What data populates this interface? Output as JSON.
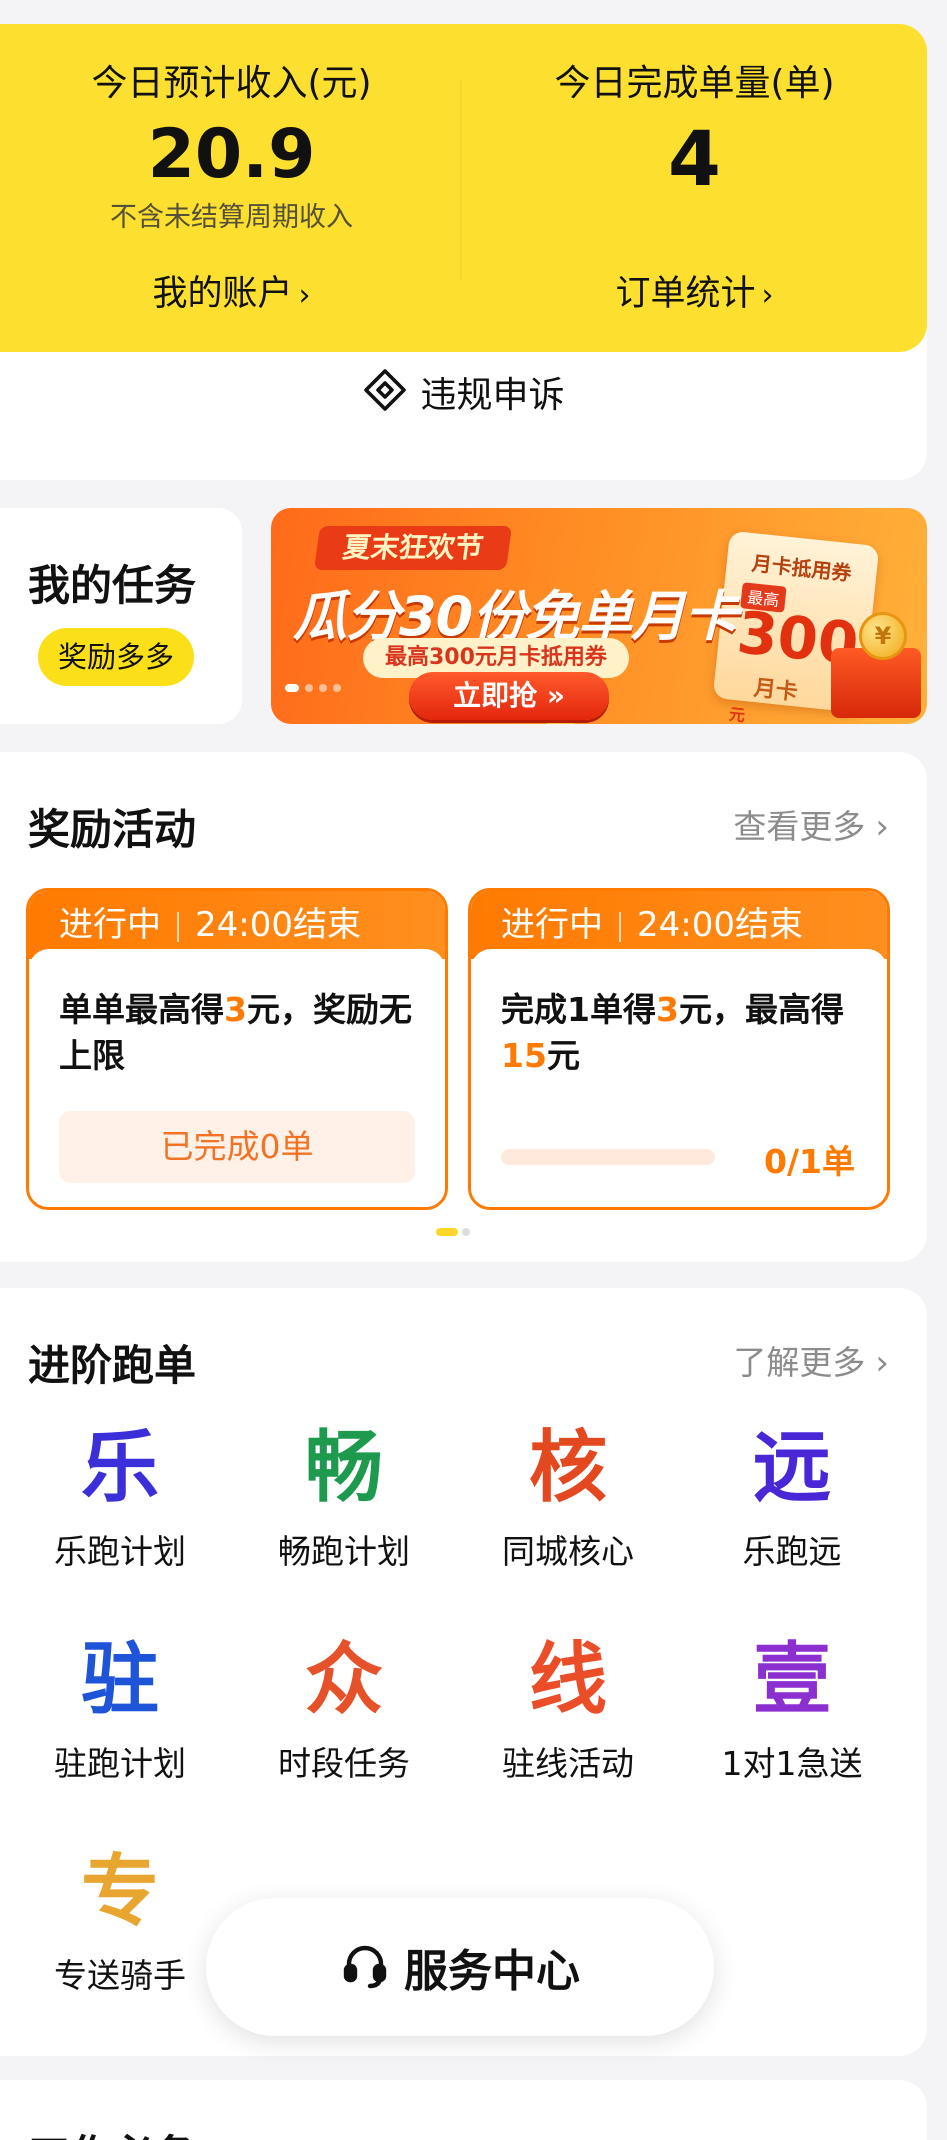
{
  "stats": {
    "income_title": "今日预计收入(元)",
    "income_value": "20.9",
    "income_note": "不含未结算周期收入",
    "account_link": "我的账户",
    "orders_title": "今日完成单量(单)",
    "orders_value": "4",
    "orders_link": "订单统计",
    "chevron": "›"
  },
  "appeal": {
    "label": "违规申诉",
    "icon": "ticket-icon"
  },
  "task": {
    "title": "我的任务",
    "badge": "奖励多多"
  },
  "banner": {
    "tag": "夏末狂欢节",
    "headline": "瓜分30份免单月卡",
    "sub": "最高300元月卡抵用券",
    "button": "立即抢 »",
    "coupon_title": "月卡抵用券",
    "coupon_max": "最高",
    "coupon_amount": "300",
    "coupon_unit": "元",
    "coupon_foot": "月卡",
    "coin": "¥"
  },
  "rewards": {
    "title": "奖励活动",
    "more": "查看更多",
    "chevron": "›",
    "cards": [
      {
        "status": "进行中",
        "end": "24:00结束",
        "text_a": "单单最高得",
        "text_hl1": "3",
        "text_b": "元，奖励无上限",
        "progress_text": "已完成0单"
      },
      {
        "status": "进行中",
        "end": "24:00结束",
        "text_a": "完成1单得",
        "text_hl1": "3",
        "text_b": "元，最高得",
        "text_hl2": "15",
        "text_c": "元",
        "progress_fraction": 0,
        "progress_label": "0/1单"
      }
    ]
  },
  "advanced": {
    "title": "进阶跑单",
    "more": "了解更多",
    "chevron": "›",
    "items": [
      {
        "glyph": "乐",
        "label": "乐跑计划",
        "color": "#3b2fd9"
      },
      {
        "glyph": "畅",
        "label": "畅跑计划",
        "color": "#1e9a4e"
      },
      {
        "glyph": "核",
        "label": "同城核心",
        "color": "#e4481f"
      },
      {
        "glyph": "远",
        "label": "乐跑远",
        "color": "#4a27d6"
      },
      {
        "glyph": "驻",
        "label": "驻跑计划",
        "color": "#1d54d8"
      },
      {
        "glyph": "众",
        "label": "时段任务",
        "color": "#e5522a"
      },
      {
        "glyph": "线",
        "label": "驻线活动",
        "color": "#ea4d27"
      },
      {
        "glyph": "壹",
        "label": "1对1急送",
        "color": "#8b2fd0"
      },
      {
        "glyph": "专",
        "label": "专送骑手",
        "color": "#e8a630"
      }
    ]
  },
  "service": {
    "label": "服务中心",
    "icon": "headset-icon"
  },
  "next_section": {
    "title": "工作必备"
  }
}
